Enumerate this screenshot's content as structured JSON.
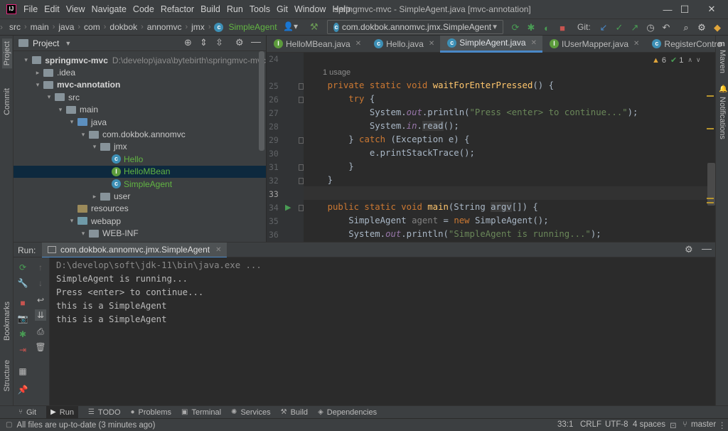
{
  "window": {
    "menu": [
      "File",
      "Edit",
      "View",
      "Navigate",
      "Code",
      "Refactor",
      "Build",
      "Run",
      "Tools",
      "Git",
      "Window",
      "Help"
    ],
    "title": "springmvc-mvc - SimpleAgent.java [mvc-annotation]",
    "minimize": "—",
    "maximize": "☐",
    "close": "✕"
  },
  "navbar": {
    "crumbs": [
      "src",
      "main",
      "java",
      "com",
      "dokbok",
      "annomvc",
      "jmx",
      "SimpleAgent"
    ],
    "run_config": "com.dokbok.annomvc.jmx.SimpleAgent",
    "git_label": "Git:"
  },
  "left_strip": {
    "project": "Project",
    "commit": "Commit",
    "bookmarks": "Bookmarks",
    "structure": "Structure"
  },
  "right_strip": {
    "maven": "Maven",
    "notifications": "Notifications"
  },
  "project": {
    "title": "Project",
    "tree": [
      {
        "label": "springmvc-mvc",
        "hint": "D:\\develop\\java\\bytebirth\\springmvc-mvc",
        "depth": 0,
        "type": "module",
        "open": true,
        "bold": true
      },
      {
        "label": ".idea",
        "depth": 1,
        "type": "folder",
        "open": false
      },
      {
        "label": "mvc-annotation",
        "depth": 1,
        "type": "module",
        "open": true,
        "bold": true
      },
      {
        "label": "src",
        "depth": 2,
        "type": "folder",
        "open": true
      },
      {
        "label": "main",
        "depth": 3,
        "type": "folder",
        "open": true
      },
      {
        "label": "java",
        "depth": 4,
        "type": "src",
        "open": true
      },
      {
        "label": "com.dokbok.annomvc",
        "depth": 5,
        "type": "folder",
        "open": true
      },
      {
        "label": "jmx",
        "depth": 6,
        "type": "folder",
        "open": true
      },
      {
        "label": "Hello",
        "depth": 7,
        "type": "class",
        "color": "#62b543"
      },
      {
        "label": "HelloMBean",
        "depth": 7,
        "type": "interface",
        "color": "#62b543",
        "selected": true
      },
      {
        "label": "SimpleAgent",
        "depth": 7,
        "type": "class",
        "color": "#62b543"
      },
      {
        "label": "user",
        "depth": 6,
        "type": "folder",
        "open": false
      },
      {
        "label": "resources",
        "depth": 4,
        "type": "res"
      },
      {
        "label": "webapp",
        "depth": 4,
        "type": "web",
        "open": true
      },
      {
        "label": "WEB-INF",
        "depth": 5,
        "type": "folder",
        "open": true
      }
    ]
  },
  "editor": {
    "tabs": [
      {
        "label": "HelloMBean.java",
        "icon": "interface",
        "active": false
      },
      {
        "label": "Hello.java",
        "icon": "class",
        "active": false
      },
      {
        "label": "SimpleAgent.java",
        "icon": "class",
        "active": true
      },
      {
        "label": "IUserMapper.java",
        "icon": "interface",
        "active": false
      },
      {
        "label": "RegisterContro",
        "icon": "class",
        "active": false
      }
    ],
    "usage_hint": "1 usage",
    "warnings": "6",
    "weak_warnings": "1",
    "lines": [
      "24",
      "25",
      "26",
      "27",
      "28",
      "29",
      "30",
      "31",
      "32",
      "33",
      "34",
      "35",
      "36"
    ]
  },
  "run": {
    "label": "Run:",
    "tab": "com.dokbok.annomvc.jmx.SimpleAgent",
    "console": [
      "D:\\develop\\soft\\jdk-11\\bin\\java.exe ...",
      "SimpleAgent is running...",
      "Press <enter> to continue...",
      "this is a SimpleAgent",
      "this is a SimpleAgent"
    ]
  },
  "bottom_tools": [
    "Git",
    "Run",
    "TODO",
    "Problems",
    "Terminal",
    "Services",
    "Build",
    "Dependencies"
  ],
  "status": {
    "message": "All files are up-to-date (3 minutes ago)",
    "position": "33:1",
    "line_sep": "CRLF",
    "encoding": "UTF-8",
    "indent": "4 spaces",
    "branch": "master"
  },
  "colors": {
    "accent": "#4a88c7",
    "selection": "#0d293e",
    "run_green": "#499c54",
    "stop_red": "#c75450"
  }
}
